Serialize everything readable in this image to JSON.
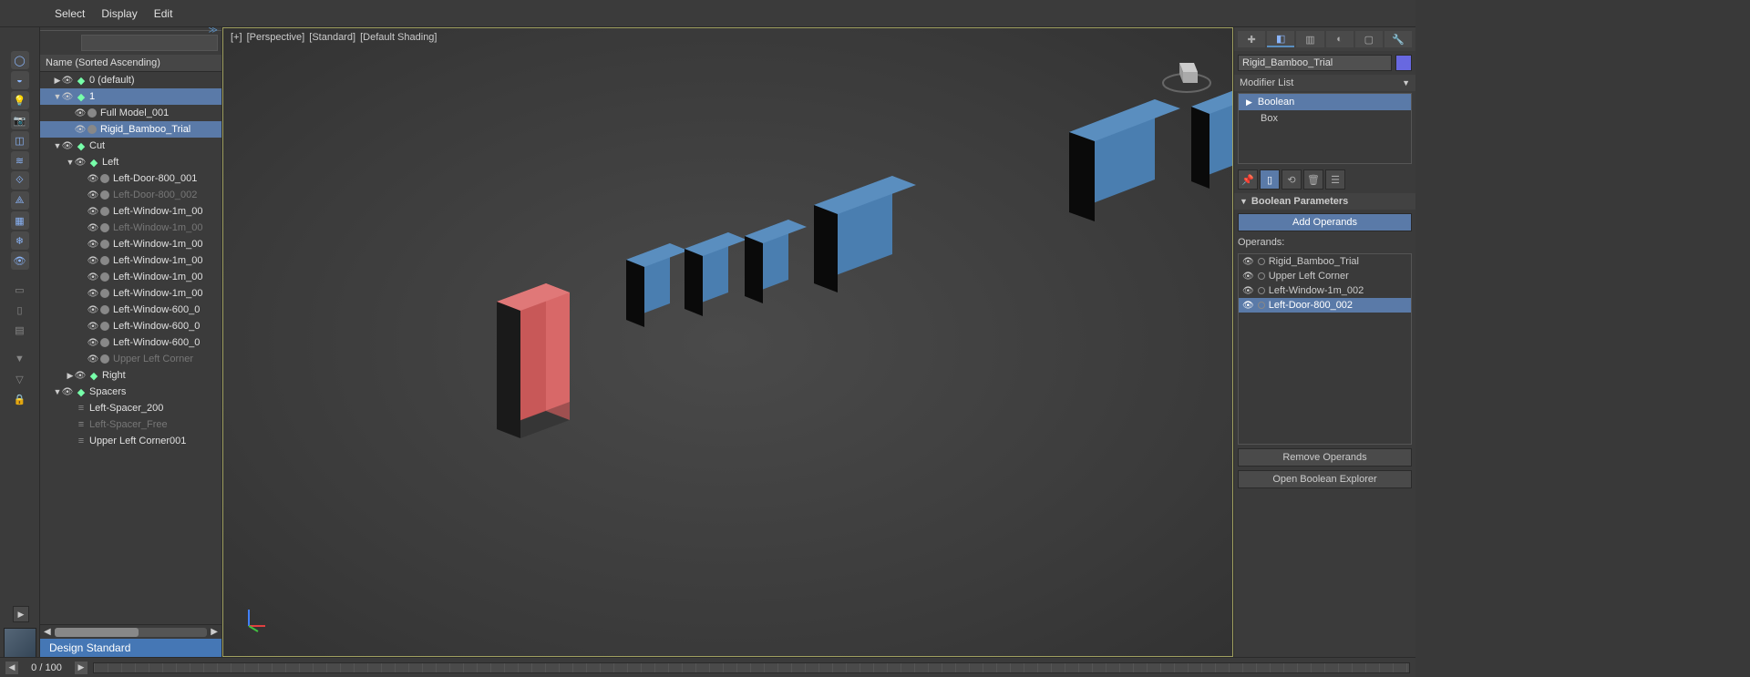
{
  "menus": {
    "select": "Select",
    "display": "Display",
    "edit": "Edit"
  },
  "outliner": {
    "header": "Name (Sorted Ascending)",
    "rows": [
      {
        "label": "0 (default)",
        "indent": 1,
        "type": "layer",
        "arrow": "▶",
        "eye": true
      },
      {
        "label": "1",
        "indent": 1,
        "type": "layer",
        "arrow": "▼",
        "eye": true,
        "sel": true
      },
      {
        "label": "Full Model_001",
        "indent": 2,
        "type": "obj",
        "eye": true
      },
      {
        "label": "Rigid_Bamboo_Trial",
        "indent": 2,
        "type": "obj",
        "eye": true,
        "sel": true
      },
      {
        "label": "Cut",
        "indent": 1,
        "type": "layer",
        "arrow": "▼",
        "eye": true
      },
      {
        "label": "Left",
        "indent": 2,
        "type": "layer",
        "arrow": "▼",
        "eye": true
      },
      {
        "label": "Left-Door-800_001",
        "indent": 3,
        "type": "obj",
        "eye": true
      },
      {
        "label": "Left-Door-800_002",
        "indent": 3,
        "type": "obj",
        "eye": true,
        "dim": true
      },
      {
        "label": "Left-Window-1m_00",
        "indent": 3,
        "type": "obj",
        "eye": true
      },
      {
        "label": "Left-Window-1m_00",
        "indent": 3,
        "type": "obj",
        "eye": true,
        "dim": true
      },
      {
        "label": "Left-Window-1m_00",
        "indent": 3,
        "type": "obj",
        "eye": true
      },
      {
        "label": "Left-Window-1m_00",
        "indent": 3,
        "type": "obj",
        "eye": true
      },
      {
        "label": "Left-Window-1m_00",
        "indent": 3,
        "type": "obj",
        "eye": true
      },
      {
        "label": "Left-Window-1m_00",
        "indent": 3,
        "type": "obj",
        "eye": true
      },
      {
        "label": "Left-Window-600_0",
        "indent": 3,
        "type": "obj",
        "eye": true
      },
      {
        "label": "Left-Window-600_0",
        "indent": 3,
        "type": "obj",
        "eye": true
      },
      {
        "label": "Left-Window-600_0",
        "indent": 3,
        "type": "obj",
        "eye": true
      },
      {
        "label": "Upper Left Corner",
        "indent": 3,
        "type": "obj",
        "eye": true,
        "dim": true
      },
      {
        "label": "Right",
        "indent": 2,
        "type": "layer",
        "arrow": "▶",
        "eye": true
      },
      {
        "label": "Spacers",
        "indent": 1,
        "type": "layer",
        "arrow": "▼",
        "eye": true
      },
      {
        "label": "Left-Spacer_200",
        "indent": 2,
        "type": "stack"
      },
      {
        "label": "Left-Spacer_Free",
        "indent": 2,
        "type": "stack",
        "dim": true
      },
      {
        "label": "Upper Left Corner001",
        "indent": 2,
        "type": "stack"
      }
    ]
  },
  "workspace": "Design Standard",
  "viewport": {
    "labels": [
      "[+]",
      "[Perspective]",
      "[Standard]",
      "[Default Shading]"
    ]
  },
  "cmd": {
    "object_name": "Rigid_Bamboo_Trial",
    "modifier_list_label": "Modifier List",
    "mod_stack": [
      {
        "name": "Boolean",
        "sel": true,
        "expandable": true
      },
      {
        "name": "Box"
      }
    ],
    "rollout_title": "Boolean Parameters",
    "add_operands": "Add Operands",
    "operands_label": "Operands:",
    "operands": [
      {
        "name": "Rigid_Bamboo_Trial"
      },
      {
        "name": "Upper Left Corner"
      },
      {
        "name": "Left-Window-1m_002"
      },
      {
        "name": "Left-Door-800_002",
        "sel": true
      }
    ],
    "remove_operands": "Remove Operands",
    "open_explorer": "Open Boolean Explorer"
  },
  "timeline": {
    "frame": "0 / 100"
  }
}
